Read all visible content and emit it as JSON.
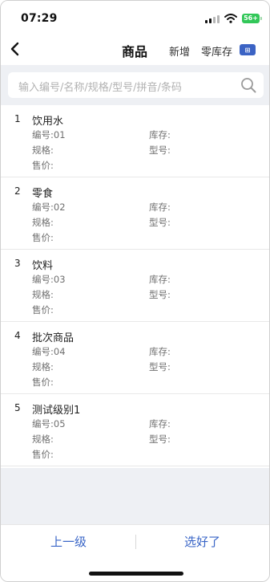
{
  "status_bar": {
    "time": "07:29",
    "battery": "56+"
  },
  "header": {
    "back_icon": "chevron-left-icon",
    "title": "商品",
    "new_label": "新增",
    "zero_stock_label": "零库存",
    "toggle_label": "⊞"
  },
  "search": {
    "placeholder": "输入编号/名称/规格/型号/拼音/条码",
    "icon": "search-icon"
  },
  "items": [
    {
      "index": "1",
      "name": "饮用水",
      "code": "编号:01",
      "stock": "库存:",
      "spec": "规格:",
      "model": "型号:",
      "price": "售价:"
    },
    {
      "index": "2",
      "name": "零食",
      "code": "编号:02",
      "stock": "库存:",
      "spec": "规格:",
      "model": "型号:",
      "price": "售价:"
    },
    {
      "index": "3",
      "name": "饮料",
      "code": "编号:03",
      "stock": "库存:",
      "spec": "规格:",
      "model": "型号:",
      "price": "售价:"
    },
    {
      "index": "4",
      "name": "批次商品",
      "code": "编号:04",
      "stock": "库存:",
      "spec": "规格:",
      "model": "型号:",
      "price": "售价:"
    },
    {
      "index": "5",
      "name": "测试级别1",
      "code": "编号:05",
      "stock": "库存:",
      "spec": "规格:",
      "model": "型号:",
      "price": "售价:"
    }
  ],
  "footer": {
    "up_label": "上一级",
    "done_label": "选好了"
  },
  "colors": {
    "accent": "#3a66c7",
    "battery": "#32c759",
    "background_gray": "#eef0f4"
  }
}
